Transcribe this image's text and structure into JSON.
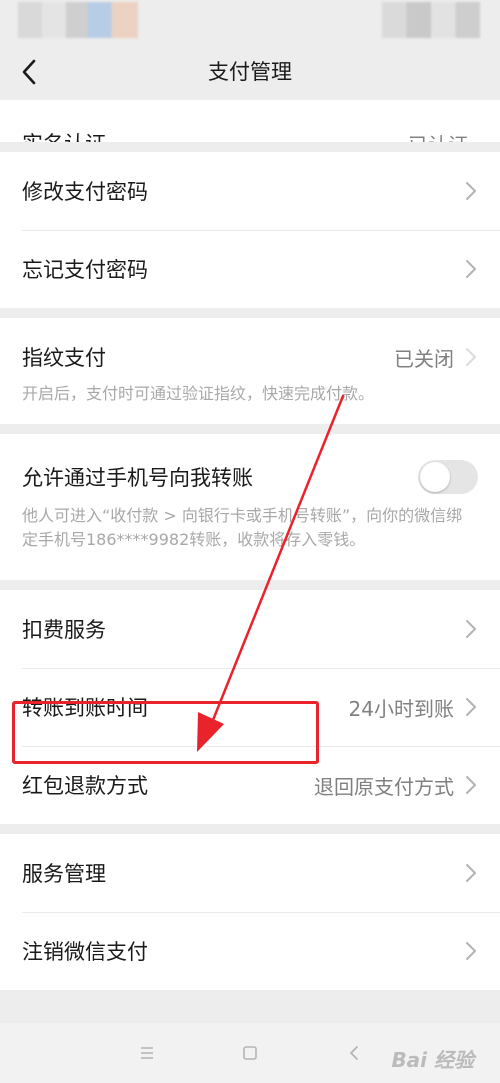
{
  "header": {
    "title": "支付管理"
  },
  "rows": {
    "realname": {
      "label": "实名认证",
      "value": "已认证"
    },
    "change_pwd": {
      "label": "修改支付密码"
    },
    "forgot_pwd": {
      "label": "忘记支付密码"
    },
    "fingerprint": {
      "label": "指纹支付",
      "value": "已关闭",
      "desc": "开启后，支付时可通过验证指纹，快速完成付款。"
    },
    "phone_transfer": {
      "label": "允许通过手机号向我转账",
      "desc": "他人可进入“收付款 > 向银行卡或手机号转账”，向你的微信绑定手机号186****9982转账，收款将存入零钱。",
      "enabled": false
    },
    "deduction": {
      "label": "扣费服务"
    },
    "transfer_time": {
      "label": "转账到账时间",
      "value": "24小时到账"
    },
    "refund": {
      "label": "红包退款方式",
      "value": "退回原支付方式"
    },
    "service_mgmt": {
      "label": "服务管理"
    },
    "cancel_pay": {
      "label": "注销微信支付"
    }
  },
  "watermark": "Bai 经验",
  "icons": [
    "back-arrow-icon",
    "chevron-right-icon",
    "menu-icon",
    "home-icon",
    "back-nav-icon"
  ],
  "colors": {
    "background": "#ededed",
    "annotation": "#e8232b",
    "secondary_text": "#808080"
  }
}
